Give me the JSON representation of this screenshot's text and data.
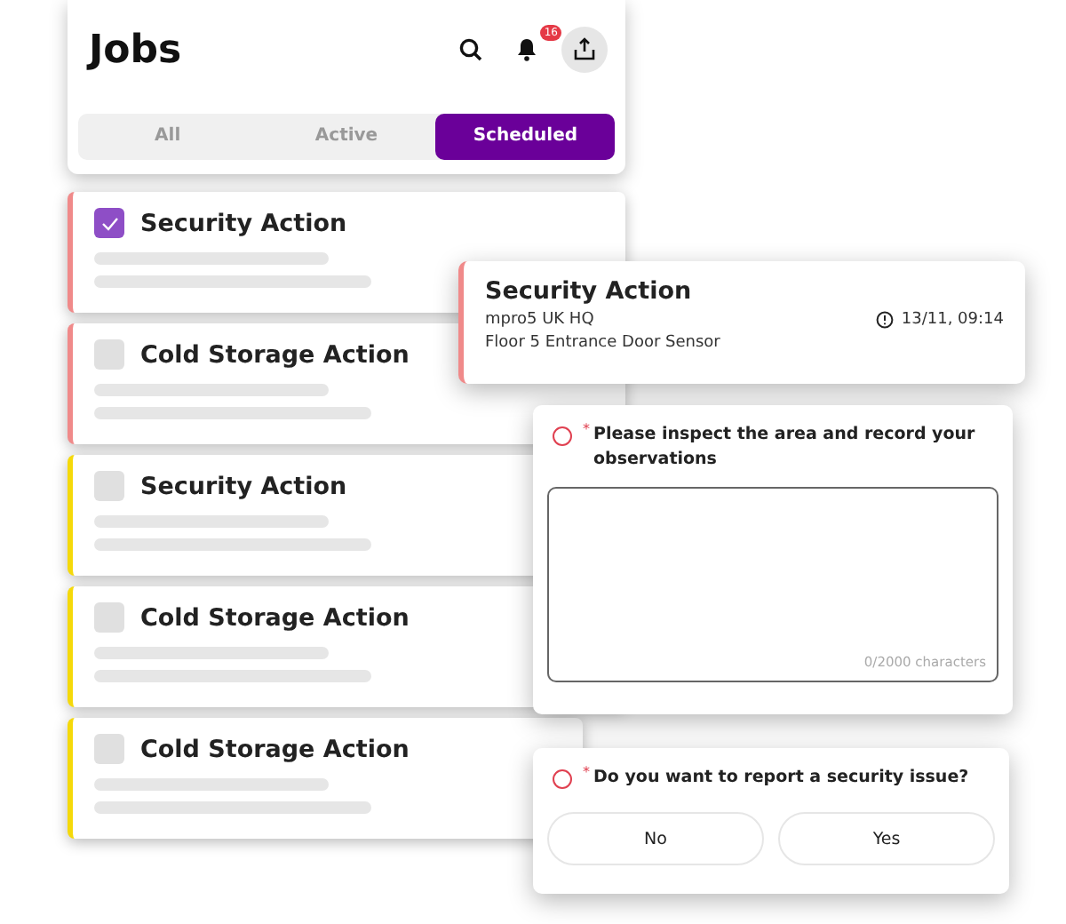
{
  "header": {
    "title": "Jobs",
    "notification_count": "16"
  },
  "tabs": [
    {
      "label": "All",
      "selected": false
    },
    {
      "label": "Active",
      "selected": false
    },
    {
      "label": "Scheduled",
      "selected": true
    }
  ],
  "jobs": [
    {
      "title": "Security Action",
      "checked": true,
      "color": "#f08a8a"
    },
    {
      "title": "Cold Storage Action",
      "checked": false,
      "color": "#f08a8a"
    },
    {
      "title": "Security Action",
      "checked": false,
      "color": "#f5d90a"
    },
    {
      "title": "Cold Storage Action",
      "checked": false,
      "color": "#f5d90a"
    },
    {
      "title": "Cold Storage Action",
      "checked": false,
      "color": "#f5d90a"
    }
  ],
  "detail": {
    "title": "Security Action",
    "site": "mpro5 UK HQ",
    "time": "13/11, 09:14",
    "location": "Floor 5 Entrance Door Sensor",
    "color": "#f08a8a"
  },
  "questions": [
    {
      "kind": "text",
      "required_mark": "*",
      "prompt": "Please inspect the area and record your observations",
      "counter": "0/2000 characters"
    },
    {
      "kind": "choice",
      "required_mark": "*",
      "prompt": "Do you want to report a security issue?",
      "options": [
        {
          "label": "No",
          "selected": false
        },
        {
          "label": "Yes",
          "selected": false
        }
      ]
    }
  ]
}
